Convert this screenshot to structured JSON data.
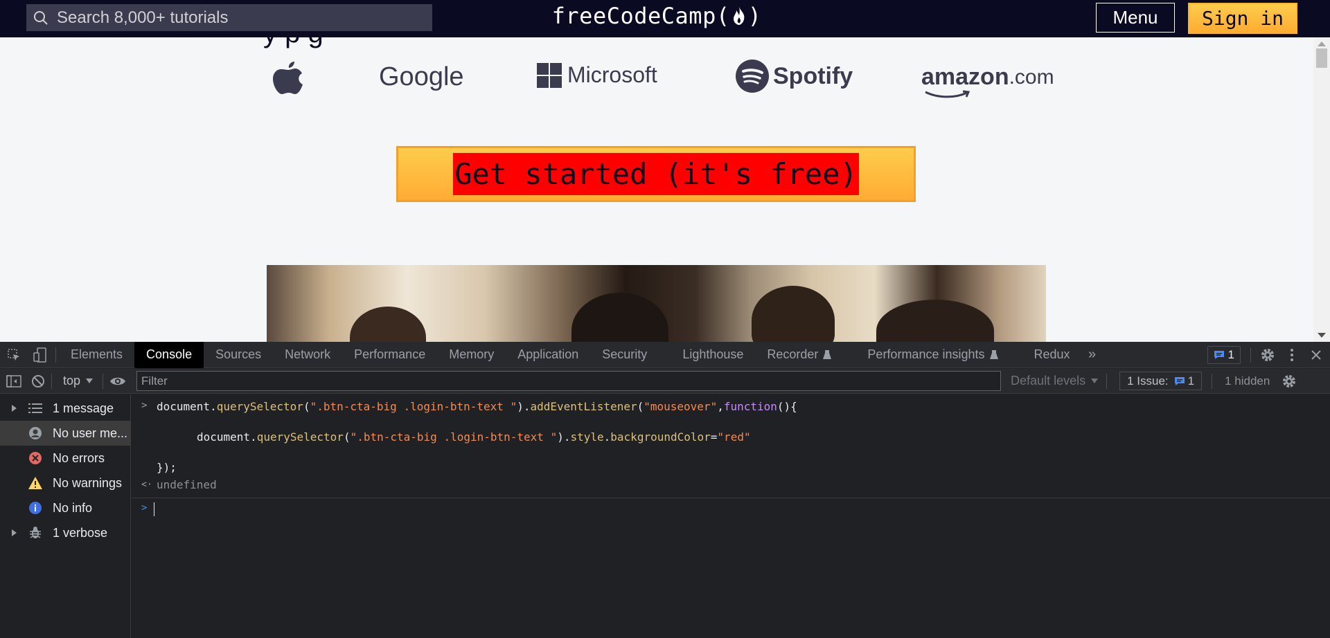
{
  "navbar": {
    "search_placeholder": "Search 8,000+ tutorials",
    "logo_text": "freeCodeCamp(",
    "logo_text_end": ")",
    "menu_label": "Menu",
    "signin_label": "Sign in"
  },
  "page": {
    "partial_heading": "y                    p                     g",
    "brands": [
      "Google",
      "Microsoft",
      "Spotify",
      "amazon",
      ".com"
    ],
    "cta_label": "Get started (it's free)"
  },
  "devtools": {
    "tabs": [
      "Elements",
      "Console",
      "Sources",
      "Network",
      "Performance",
      "Memory",
      "Application",
      "Security",
      "Lighthouse",
      "Recorder",
      "Performance insights",
      "Redux"
    ],
    "active_tab": "Console",
    "issue_badge_count": "1",
    "context": "top",
    "filter_placeholder": "Filter",
    "levels": "Default levels",
    "issues_label": "1 Issue:",
    "issues_count": "1",
    "hidden": "1 hidden",
    "sidebar": [
      "1 message",
      "No user me...",
      "No errors",
      "No warnings",
      "No info",
      "1 verbose"
    ],
    "console": {
      "line1": {
        "a": "document.",
        "b": "querySelector",
        "c": "(",
        "d": "\".btn-cta-big .login-btn-text \"",
        "e": ").",
        "f": "addEventListener",
        "g": "(",
        "h": "\"mouseover\"",
        "i": ",",
        "j": "function",
        "k": "(){"
      },
      "line2": {
        "a": "document.",
        "b": "querySelector",
        "c": "(",
        "d": "\".btn-cta-big .login-btn-text \"",
        "e": ").",
        "f": "style",
        "g": ".",
        "h": "backgroundColor",
        "i": "=",
        "j": "\"red\""
      },
      "line3": "});",
      "result": "undefined"
    }
  },
  "colors": {
    "nav_bg": "#0a0a23",
    "accent_yellow": "#ffb428",
    "cta_highlight": "#ff0000",
    "devtools_bg": "#202124"
  }
}
